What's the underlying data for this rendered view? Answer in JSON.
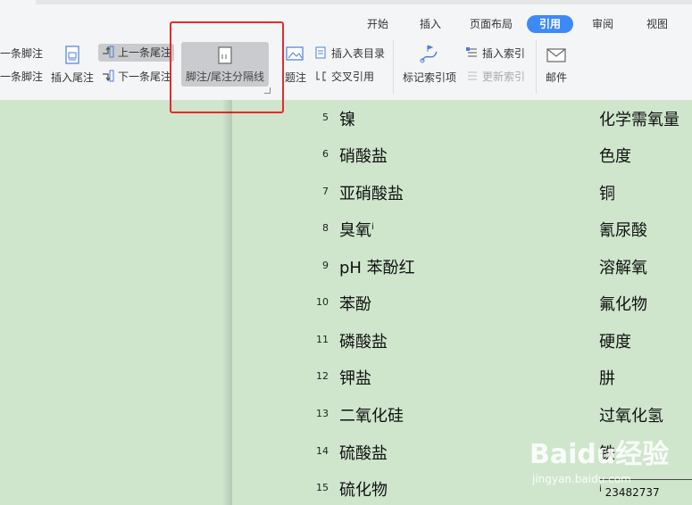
{
  "ribbon": {
    "tabs": [
      {
        "label": "开始"
      },
      {
        "label": "插入"
      },
      {
        "label": "页面布局"
      },
      {
        "label": "引用"
      },
      {
        "label": "审阅"
      },
      {
        "label": "视图"
      }
    ],
    "buttons": {
      "insert_footnote_partial": "一条脚注",
      "next_footnote_partial": "一条脚注",
      "insert_endnote": "插入尾注",
      "prev_endnote": "上一条尾注",
      "next_endnote": "下一条尾注",
      "separator": "脚注/尾注分隔线",
      "caption_partial": "题注",
      "insert_toc_table": "插入表目录",
      "cross_ref": "交叉引用",
      "mark_index": "标记索引项",
      "insert_index": "插入索引",
      "update_index": "更新索引",
      "mail": "邮件"
    }
  },
  "document": {
    "rows": [
      {
        "num": "5",
        "left": "镍",
        "right": "化学需氧量"
      },
      {
        "num": "6",
        "left": "硝酸盐",
        "right": "色度"
      },
      {
        "num": "7",
        "left": "亚硝酸盐",
        "right": "铜"
      },
      {
        "num": "8",
        "left": "臭氧",
        "sup": "i",
        "right": "氰尿酸"
      },
      {
        "num": "9",
        "left": "pH 苯酚红",
        "right": "溶解氧"
      },
      {
        "num": "10",
        "left": "苯酚",
        "right": "氟化物"
      },
      {
        "num": "11",
        "left": "磷酸盐",
        "right": "硬度"
      },
      {
        "num": "12",
        "left": "钾盐",
        "right": "肼"
      },
      {
        "num": "13",
        "left": "二氧化硅",
        "right": "过氧化氢"
      },
      {
        "num": "14",
        "left": "硫酸盐",
        "right": "铁"
      },
      {
        "num": "15",
        "left": "硫化物",
        "right": ""
      }
    ],
    "footnote": {
      "mark": "i",
      "text": "23482737"
    }
  },
  "watermark": {
    "logo": "Baidu经验",
    "url": "jingyan.baidu.com"
  }
}
